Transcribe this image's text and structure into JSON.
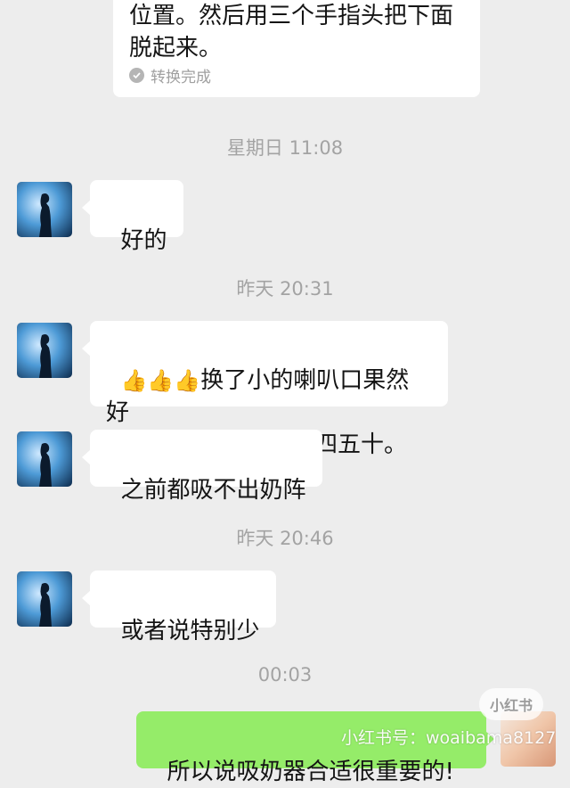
{
  "conversion_card": {
    "text": "位置。然后用三个手指头把下面\n脱起来。",
    "status": "转换完成"
  },
  "timestamps": [
    "星期日 11:08",
    "昨天 20:31",
    "昨天 20:46",
    "00:03"
  ],
  "messages": [
    {
      "text": "好的"
    },
    {
      "emoji": "👍👍👍",
      "text": "换了小的喇叭口果然好\n用。一个小时吸出了四五十。"
    },
    {
      "text": "之前都吸不出奶阵"
    },
    {
      "text": "或者说特别少"
    },
    {
      "text": "所以说吸奶器合适很重要的!"
    }
  ],
  "watermark": {
    "logo": "小红书",
    "id": "小红书号：woaibama8127"
  },
  "colors": {
    "background": "#ededed",
    "incoming_bubble": "#ffffff",
    "outgoing_bubble": "#95ec69",
    "timestamp": "#a3a3a3"
  },
  "icons": [
    "check-icon",
    "avatar"
  ]
}
